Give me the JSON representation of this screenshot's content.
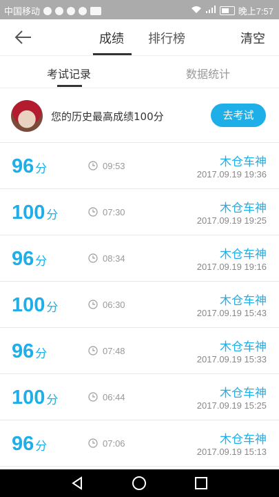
{
  "status_bar": {
    "carrier": "中国移动",
    "time": "晚上7:57"
  },
  "header": {
    "back_icon": "back-arrow-icon",
    "tab_scores": "成绩",
    "tab_ranking": "排行榜",
    "clear": "清空"
  },
  "subtabs": {
    "records": "考试记录",
    "stats": "数据统计"
  },
  "best": {
    "text": "您的历史最高成绩100分",
    "button": "去考试"
  },
  "accent_color": "#1eaee8",
  "score_unit": "分",
  "records": [
    {
      "score": "96",
      "duration": "09:53",
      "name": "木仓车神",
      "date": "2017.09.19  19:36"
    },
    {
      "score": "100",
      "duration": "07:30",
      "name": "木仓车神",
      "date": "2017.09.19  19:25"
    },
    {
      "score": "96",
      "duration": "08:34",
      "name": "木仓车神",
      "date": "2017.09.19  19:16"
    },
    {
      "score": "100",
      "duration": "06:30",
      "name": "木仓车神",
      "date": "2017.09.19  15:43"
    },
    {
      "score": "96",
      "duration": "07:48",
      "name": "木仓车神",
      "date": "2017.09.19  15:33"
    },
    {
      "score": "100",
      "duration": "06:44",
      "name": "木仓车神",
      "date": "2017.09.19  15:25"
    },
    {
      "score": "96",
      "duration": "07:06",
      "name": "木仓车神",
      "date": "2017.09.19  15:13"
    }
  ]
}
